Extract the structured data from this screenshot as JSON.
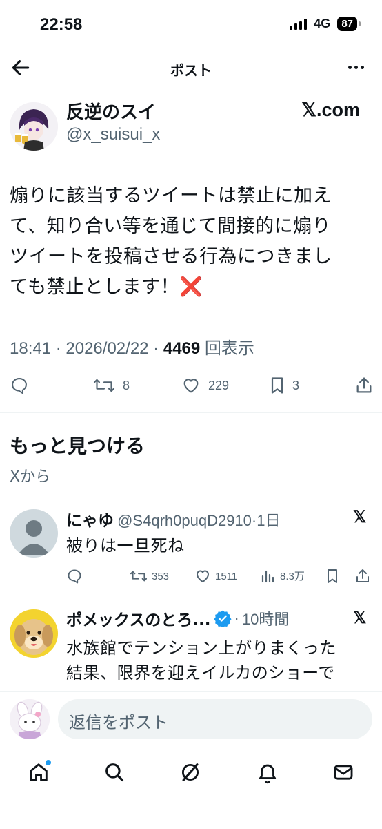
{
  "status_bar": {
    "time": "22:58",
    "network": "4G",
    "battery": "87"
  },
  "header": {
    "title": "ポスト"
  },
  "tweet": {
    "author_name": "反逆のスイ",
    "author_handle": "@x_suisui_x",
    "link_text": "𝕏.com",
    "text_lines": [
      "煽りに該当するツイートは禁止に加え",
      "て、知り合い等を通じて間接的に煽り",
      "ツイートを投稿させる行為につきまし",
      "ても禁止とします！"
    ],
    "emoji": "❌",
    "time": "18:41",
    "date": "2026/02/22",
    "views": "4469",
    "views_label": "回表示",
    "retweets": "8",
    "likes": "229",
    "bookmarks": "3"
  },
  "discover": {
    "title": "もっと見つける",
    "subtitle": "Xから"
  },
  "replies": [
    {
      "name": "にゃゆ",
      "handle": "@S4qrh0puqD2910",
      "time": "1日",
      "x_label": "𝕏",
      "text": "被りは一旦死ね",
      "replies": "",
      "retweets": "353",
      "likes": "1511",
      "views": "8.3万"
    },
    {
      "name": "ポメックスのとろ...",
      "time": "10時間",
      "x_label": "𝕏",
      "text_lines": [
        "水族館でテンション上がりまくった",
        "結果、限界を迎えイルカのショーで"
      ]
    }
  ],
  "compose": {
    "placeholder": "返信をポスト"
  },
  "colors": {
    "accent": "#1d9bf0",
    "text": "#0f1419",
    "secondary": "#536471",
    "error": "#e0245e"
  }
}
